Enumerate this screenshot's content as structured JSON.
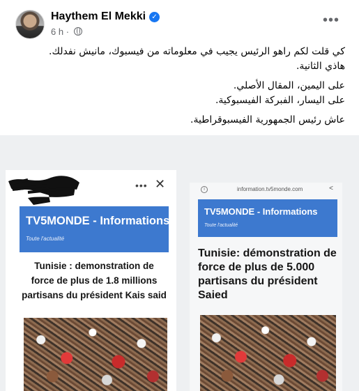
{
  "post": {
    "author": "Haythem El Mekki",
    "timestamp": "6 h",
    "separator": "·",
    "more_icon": "more-horizontal-icon",
    "verified_icon": "verified-badge-icon",
    "audience_icon": "globe-icon",
    "text_lines": [
      "كي قلت لكم راهو الرئيس يجيب في معلوماته من فيسبوك، مانيش نفدلك.",
      "هاذي الثانية.",
      "على اليمين، المقال الأصلي.",
      "على اليسار، الفبركة الفيسبوكية.",
      "عاش رئيس الجمهورية الفيسبوقراطية."
    ]
  },
  "image": {
    "left": {
      "dots": "•••",
      "close": "✕",
      "banner_title": "TV5MONDE - Informations",
      "banner_sub": "Toute l'actualité",
      "headline_lines": [
        "Tunisie : demonstration de",
        "force de plus  de 1.8 millions",
        "partisans du président Kais said"
      ]
    },
    "right": {
      "url": "information.tv5monde.com",
      "banner_title": "TV5MONDE - Informations",
      "banner_sub": "Toute l'actualité",
      "headline_lines": [
        "Tunisie: démonstration de",
        "force de plus de 5.000",
        "partisans du président",
        "Saied"
      ]
    }
  },
  "colors": {
    "tv5_blue": "#3d79cf",
    "facebook_blue": "#1877f2",
    "meta_gray": "#65676b"
  }
}
